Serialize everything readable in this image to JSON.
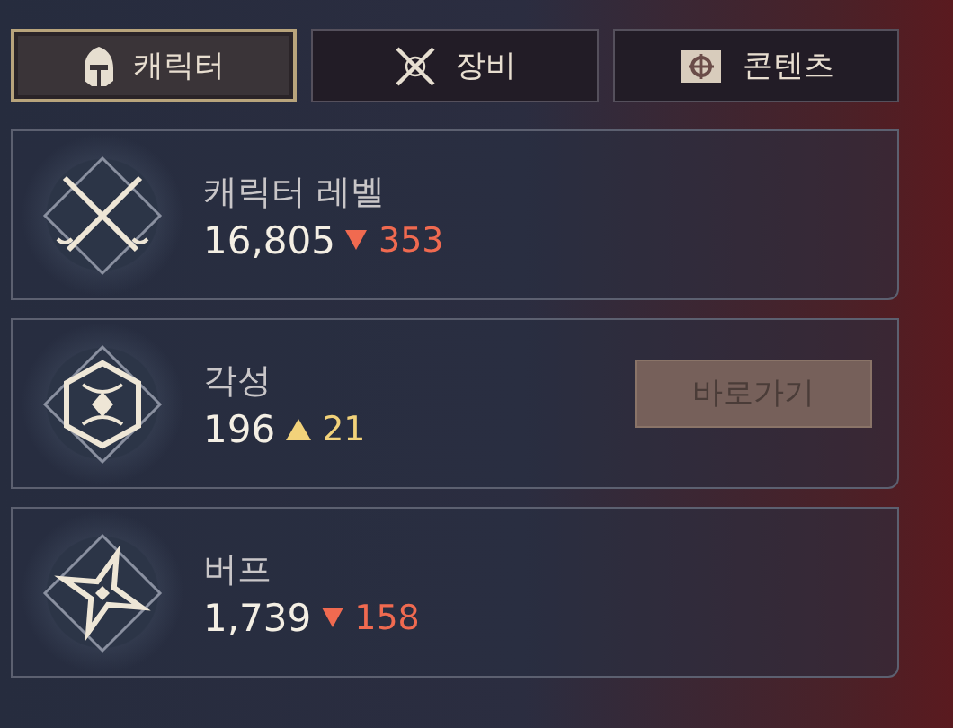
{
  "tabs": [
    {
      "label": "캐릭터",
      "selected": true
    },
    {
      "label": "장비",
      "selected": false
    },
    {
      "label": "콘텐츠",
      "selected": false
    }
  ],
  "stats": [
    {
      "title": "캐릭터 레벨",
      "value": "16,805",
      "change": {
        "kind": "decrease",
        "amount": "353"
      }
    },
    {
      "title": "각성",
      "value": "196",
      "change": {
        "kind": "increase",
        "amount": "21"
      },
      "action": "바로가기"
    },
    {
      "title": "버프",
      "value": "1,739",
      "change": {
        "kind": "decrease",
        "amount": "158"
      }
    }
  ]
}
